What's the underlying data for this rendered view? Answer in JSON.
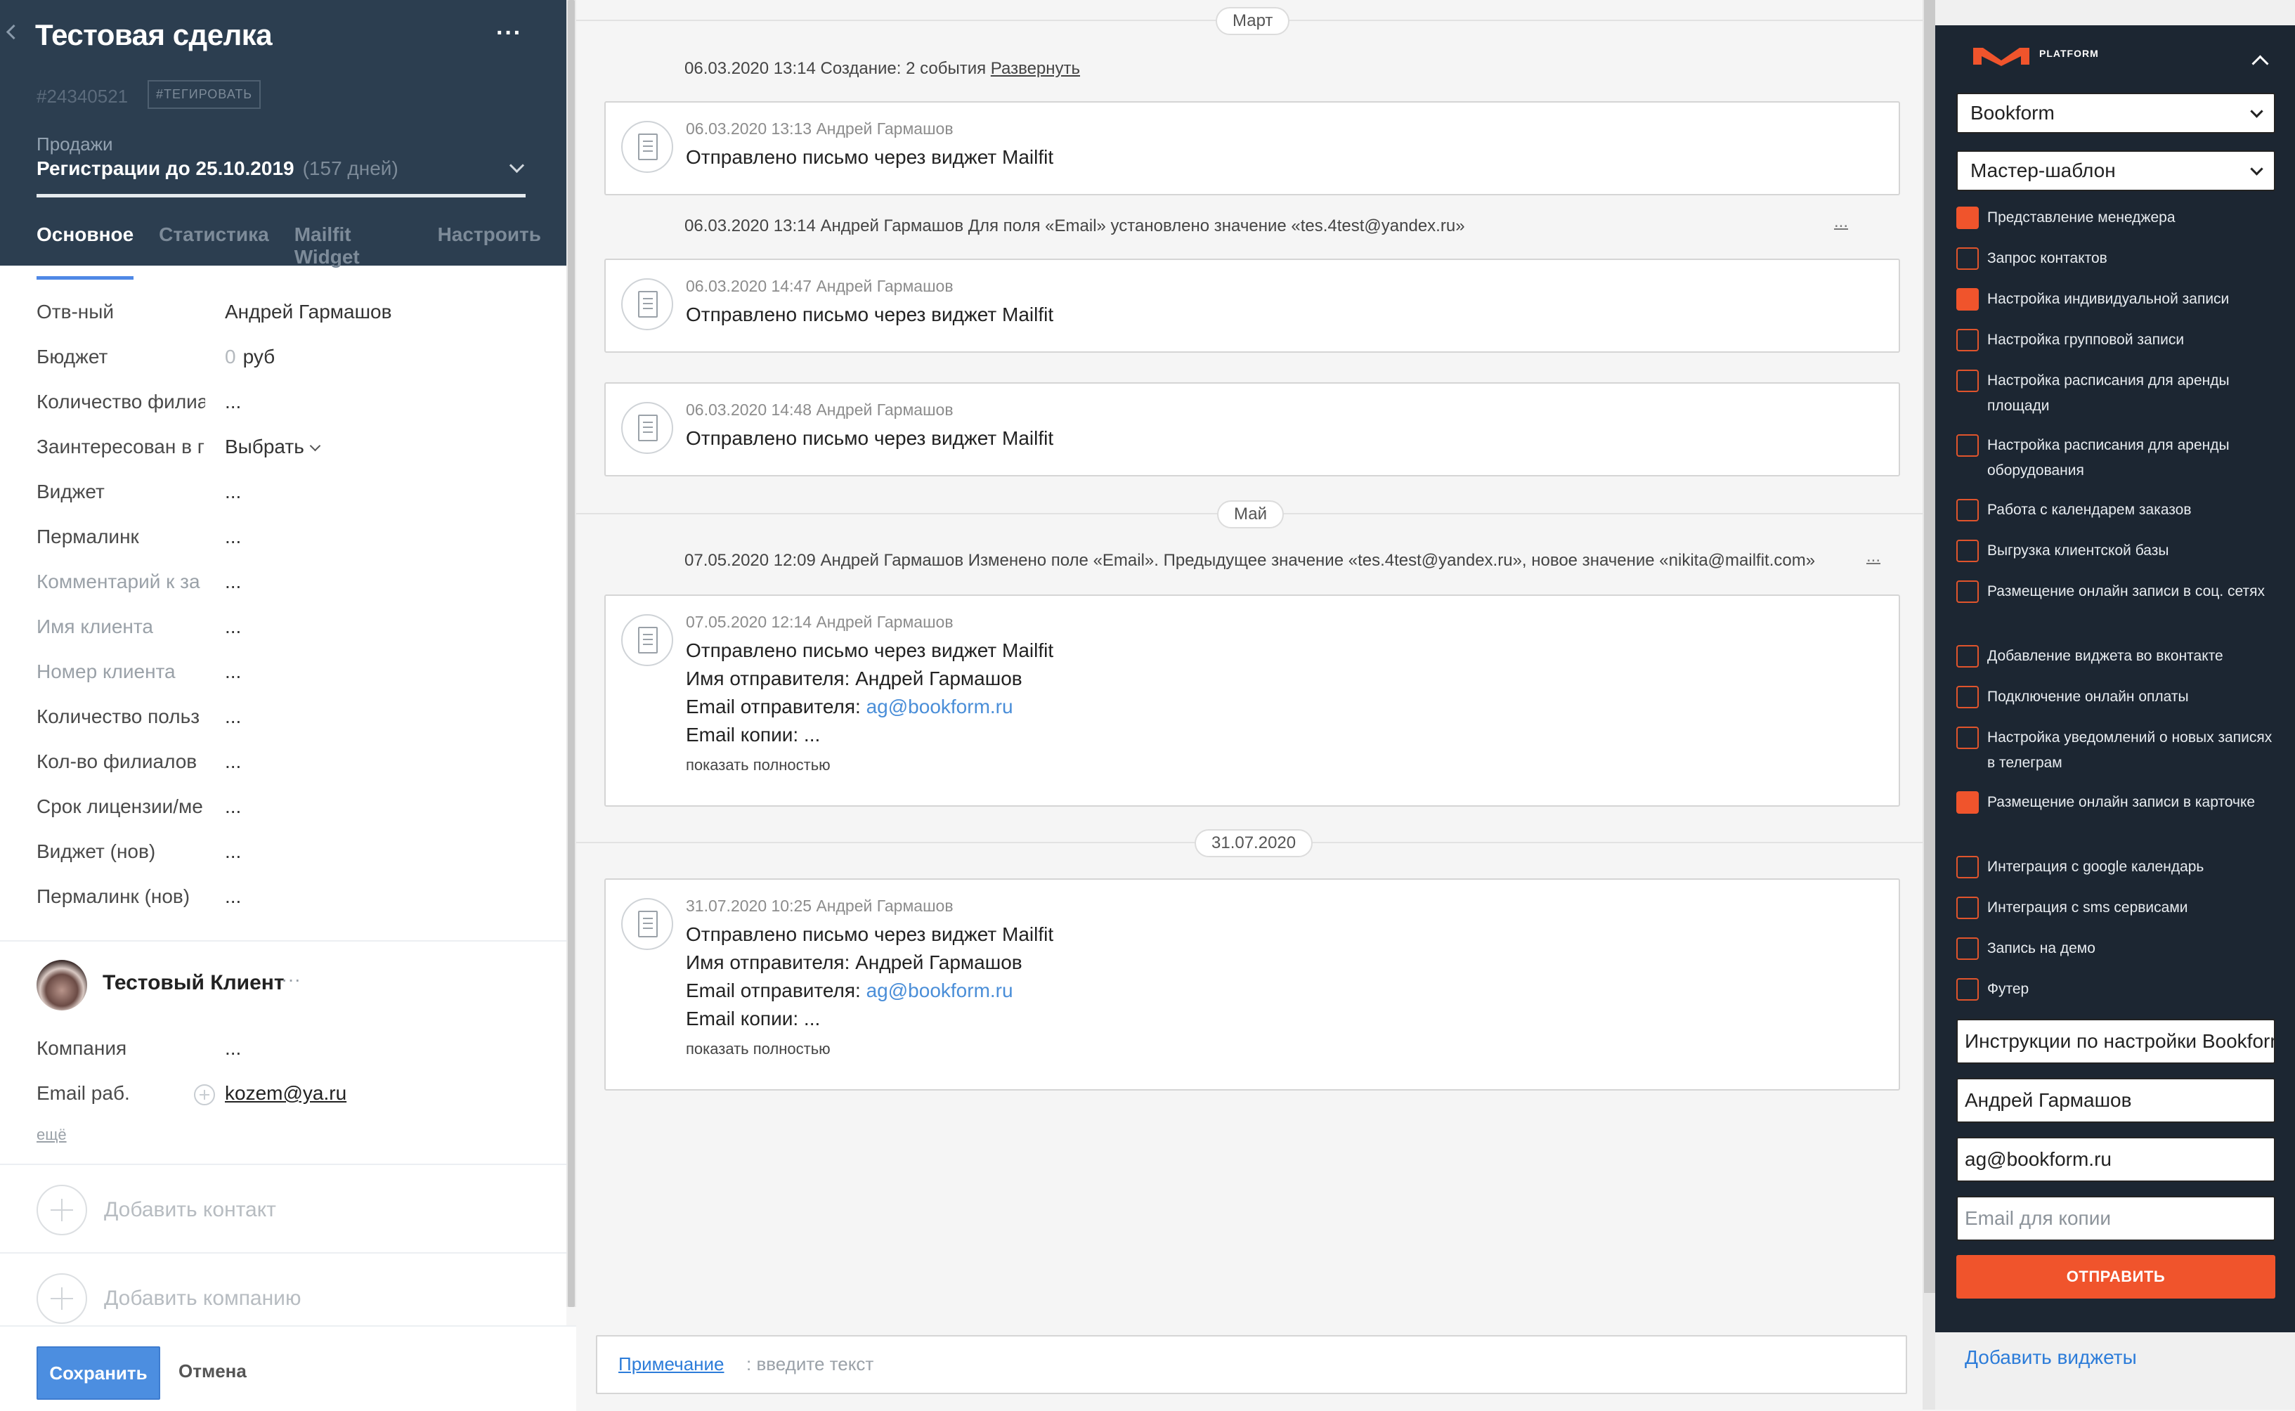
{
  "deal": {
    "title": "Тестовая сделка",
    "id": "#24340521",
    "tag_button": "#ТЕГИРОВАТЬ",
    "pipeline": "Продажи",
    "stage": "Регистрации до 25.10.2019",
    "stage_days": "(157 дней)",
    "stage_progress": 1.0,
    "tabs": [
      "Основное",
      "Статистика",
      "Mailfit Widget",
      "Настроить"
    ],
    "active_tab": "Основное"
  },
  "fields": [
    {
      "label": "Отв-ный",
      "value": "Андрей Гармашов"
    },
    {
      "label": "Бюджет",
      "value_zero": "0",
      "value": "руб"
    },
    {
      "label": "Количество филиа",
      "value": "..."
    },
    {
      "label": "Заинтересован в г",
      "value": "Выбрать"
    },
    {
      "label": "Виджет",
      "value": "..."
    },
    {
      "label": "Пермалинк",
      "value": "..."
    },
    {
      "label": "Комментарий к за",
      "value": "..."
    },
    {
      "label": "Имя клиента",
      "value": "..."
    },
    {
      "label": "Номер клиента",
      "value": "..."
    },
    {
      "label": "Количество польз",
      "value": "..."
    },
    {
      "label": "Кол-во филиалов",
      "value": "..."
    },
    {
      "label": "Срок лицензии/ме",
      "value": "..."
    },
    {
      "label": "Виджет (нов)",
      "value": "..."
    },
    {
      "label": "Пермалинк (нов)",
      "value": "..."
    }
  ],
  "contact": {
    "name": "Тестовый Клиент",
    "dots": "···",
    "company_label": "Компания",
    "company_value": "...",
    "email_label": "Email раб.",
    "email_value": "kozem@ya.ru",
    "more": "ещё"
  },
  "add_contact": "Добавить контакт",
  "add_company": "Добавить компанию",
  "footer": {
    "save": "Сохранить",
    "cancel": "Отмена"
  },
  "timeline": {
    "months": [
      "Март",
      "Май",
      "31.07.2020"
    ],
    "events": [
      {
        "text": "06.03.2020 13:14 Создание: 2 события ",
        "link": "Развернуть"
      },
      {
        "text": "06.03.2020 13:14 Андрей Гармашов  Для поля «Email» установлено значение «tes.4test@yandex.ru»",
        "dots": "..."
      },
      {
        "text": "07.05.2020 12:09 Андрей Гармашов  Изменено поле «Email». Предыдущее значение «tes.4test@yandex.ru», новое значение «nikita@mailfit.com»",
        "dots": "..."
      }
    ],
    "cards": [
      {
        "meta": "06.03.2020 13:13 Андрей Гармашов",
        "line1": "Отправлено письмо через виджет Mailfit"
      },
      {
        "meta": "06.03.2020 14:47 Андрей Гармашов",
        "line1": "Отправлено письмо через виджет Mailfit"
      },
      {
        "meta": "06.03.2020 14:48 Андрей Гармашов",
        "line1": "Отправлено письмо через виджет Mailfit"
      },
      {
        "meta": "07.05.2020 12:14 Андрей Гармашов",
        "line1": "Отправлено письмо через виджет Mailfit",
        "line2": "Имя отправителя: Андрей Гармашов",
        "line3_label": "Email отправителя: ",
        "line3_email": "ag@bookform.ru",
        "line4": "Email копии: ...",
        "more": "показать полностью"
      },
      {
        "meta": "31.07.2020 10:25 Андрей Гармашов",
        "line1": "Отправлено письмо через виджет Mailfit",
        "line2": "Имя отправителя: Андрей Гармашов",
        "line3_label": "Email отправителя: ",
        "line3_email": "ag@bookform.ru",
        "line4": "Email копии: ...",
        "more": "показать полностью"
      }
    ],
    "note_label": "Примечание",
    "note_placeholder": ": введите текст"
  },
  "widget": {
    "logo_text": "PLATFORM",
    "accent_color": "#f0542c",
    "select_project": "Bookform",
    "select_template": "Мастер-шаблон",
    "checklist": [
      {
        "label": "Представление менеджера",
        "checked": true
      },
      {
        "label": "Запрос контактов",
        "checked": false
      },
      {
        "label": "Настройка индивидуальной записи",
        "checked": true
      },
      {
        "label": "Настройка групповой записи",
        "checked": false
      },
      {
        "label": "Настройка расписания для аренды площади",
        "checked": false
      },
      {
        "label": "Настройка расписания для аренды оборудования",
        "checked": false
      },
      {
        "label": "Работа с календарем заказов",
        "checked": false
      },
      {
        "label": "Выгрузка клиентской базы",
        "checked": false
      },
      {
        "label": "Размещение онлайн записи в соц. сетях",
        "checked": false
      },
      {
        "label": "Добавление виджета во вконтакте",
        "checked": false
      },
      {
        "label": "Подключение онлайн оплаты",
        "checked": false
      },
      {
        "label": "Настройка уведомлений о новых записях в телеграм",
        "checked": false
      },
      {
        "label": "Размещение онлайн записи в карточке",
        "checked": true
      },
      {
        "label": "Интеграция с google календарь",
        "checked": false
      },
      {
        "label": "Интеграция с sms сервисами",
        "checked": false
      },
      {
        "label": "Запись на демо",
        "checked": false
      },
      {
        "label": "Футер",
        "checked": false
      }
    ],
    "subject": "Инструкции по настройки Bookform",
    "sender_name": "Андрей Гармашов",
    "sender_email": "ag@bookform.ru",
    "copy_placeholder": "Email для копии",
    "send": "ОТПРАВИТЬ"
  },
  "add_widgets": "Добавить виджеты"
}
